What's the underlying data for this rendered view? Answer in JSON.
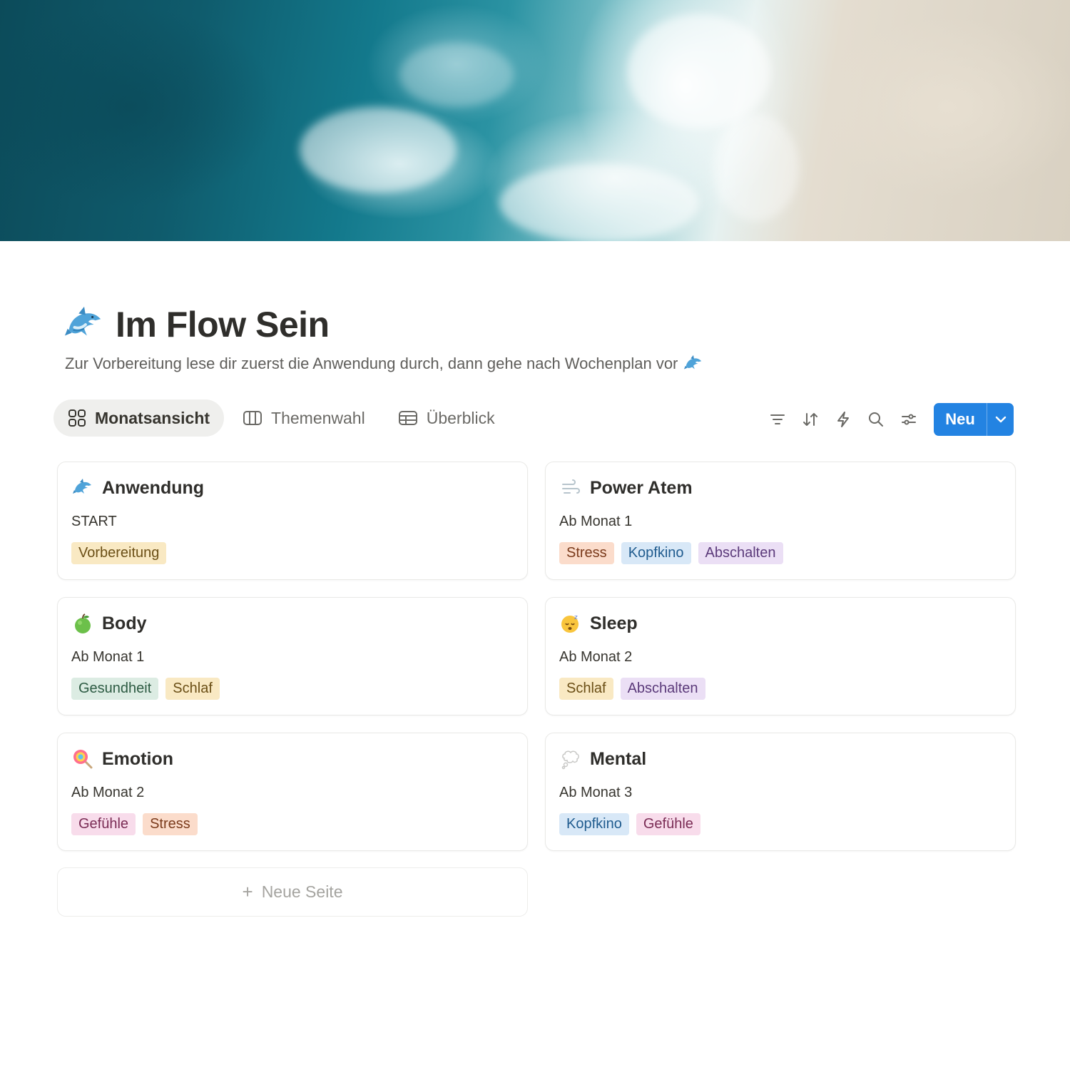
{
  "page": {
    "title": "Im Flow Sein",
    "subtitle": "Zur Vorbereitung lese dir zuerst die Anwendung durch, dann gehe nach Wochenplan vor",
    "icon": "dolphin-icon"
  },
  "views": [
    {
      "label": "Monatsansicht",
      "icon": "gallery-icon",
      "active": true
    },
    {
      "label": "Themenwahl",
      "icon": "board-icon",
      "active": false
    },
    {
      "label": "Überblick",
      "icon": "table-icon",
      "active": false
    }
  ],
  "toolbar": {
    "icons": [
      "filter-icon",
      "sort-icon",
      "automation-icon",
      "search-icon",
      "settings-icon"
    ],
    "new_label": "Neu"
  },
  "cards": [
    {
      "title": "Anwendung",
      "icon": "dolphin-icon",
      "subtitle": "START",
      "tags": [
        {
          "label": "Vorbereitung",
          "color": "yellow"
        }
      ]
    },
    {
      "title": "Power Atem",
      "icon": "wind-icon",
      "subtitle": "Ab Monat 1",
      "tags": [
        {
          "label": "Stress",
          "color": "orange"
        },
        {
          "label": "Kopfkino",
          "color": "blue"
        },
        {
          "label": "Abschalten",
          "color": "purple"
        }
      ]
    },
    {
      "title": "Body",
      "icon": "green-apple-icon",
      "subtitle": "Ab Monat 1",
      "tags": [
        {
          "label": "Gesundheit",
          "color": "green"
        },
        {
          "label": "Schlaf",
          "color": "yellow"
        }
      ]
    },
    {
      "title": "Sleep",
      "icon": "sleeping-face-icon",
      "subtitle": "Ab Monat 2",
      "tags": [
        {
          "label": "Schlaf",
          "color": "yellow"
        },
        {
          "label": "Abschalten",
          "color": "purple"
        }
      ]
    },
    {
      "title": "Emotion",
      "icon": "lollipop-icon",
      "subtitle": "Ab Monat 2",
      "tags": [
        {
          "label": "Gefühle",
          "color": "pink"
        },
        {
          "label": "Stress",
          "color": "orange"
        }
      ]
    },
    {
      "title": "Mental",
      "icon": "thought-bubble-icon",
      "subtitle": "Ab Monat 3",
      "tags": [
        {
          "label": "Kopfkino",
          "color": "blue"
        },
        {
          "label": "Gefühle",
          "color": "pink"
        }
      ]
    }
  ],
  "new_page_label": "Neue Seite",
  "tag_colors": {
    "yellow": {
      "bg": "#f9e9c3",
      "fg": "#6b4f16"
    },
    "orange": {
      "bg": "#fbdccb",
      "fg": "#7a3a1b"
    },
    "blue": {
      "bg": "#d8e8f7",
      "fg": "#1f5b8e"
    },
    "purple": {
      "bg": "#ebdff5",
      "fg": "#5b3a7a"
    },
    "green": {
      "bg": "#dcece3",
      "fg": "#2d5b43"
    },
    "pink": {
      "bg": "#f8dceb",
      "fg": "#7a2c55"
    }
  },
  "accent": "#2383e2"
}
